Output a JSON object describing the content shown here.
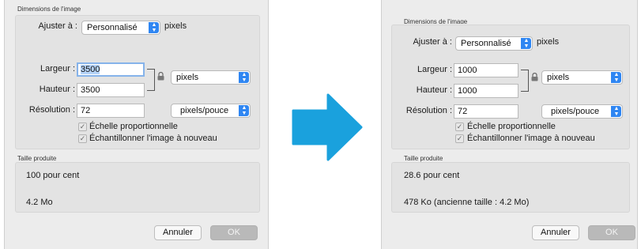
{
  "colors": {
    "panel_bg": "#ececec",
    "group_bg": "#e3e3e3",
    "accent_blue": "#2f86f2",
    "arrow_blue": "#1aa1dd"
  },
  "icons": {
    "lock": "lock-icon",
    "checkbox": "checkmark-icon",
    "popup": "up-down-chevron-icon",
    "transition": "right-arrow-icon"
  },
  "before": {
    "dims_title": "Dimensions de l'image",
    "fit_label": "Ajuster à :",
    "fit_value": "Personnalisé",
    "fit_unit": "pixels",
    "width_label": "Largeur :",
    "width_value": "3500",
    "height_label": "Hauteur :",
    "height_value": "3500",
    "size_unit": "pixels",
    "res_label": "Résolution :",
    "res_value": "72",
    "res_unit": "pixels/pouce",
    "scale_label": "Échelle proportionnelle",
    "resample_label": "Échantillonner l'image à nouveau",
    "result_title": "Taille produite",
    "result_percent": "100 pour cent",
    "result_size": "4.2 Mo",
    "cancel_label": "Annuler",
    "ok_label": "OK"
  },
  "after": {
    "dims_title": "Dimensions de l'image",
    "fit_label": "Ajuster à :",
    "fit_value": "Personnalisé",
    "fit_unit": "pixels",
    "width_label": "Largeur :",
    "width_value": "1000",
    "height_label": "Hauteur :",
    "height_value": "1000",
    "size_unit": "pixels",
    "res_label": "Résolution :",
    "res_value": "72",
    "res_unit": "pixels/pouce",
    "scale_label": "Échelle proportionnelle",
    "resample_label": "Échantillonner l'image à nouveau",
    "result_title": "Taille produite",
    "result_percent": "28.6 pour cent",
    "result_size": "478 Ko (ancienne taille : 4.2 Mo)",
    "cancel_label": "Annuler",
    "ok_label": "OK"
  }
}
